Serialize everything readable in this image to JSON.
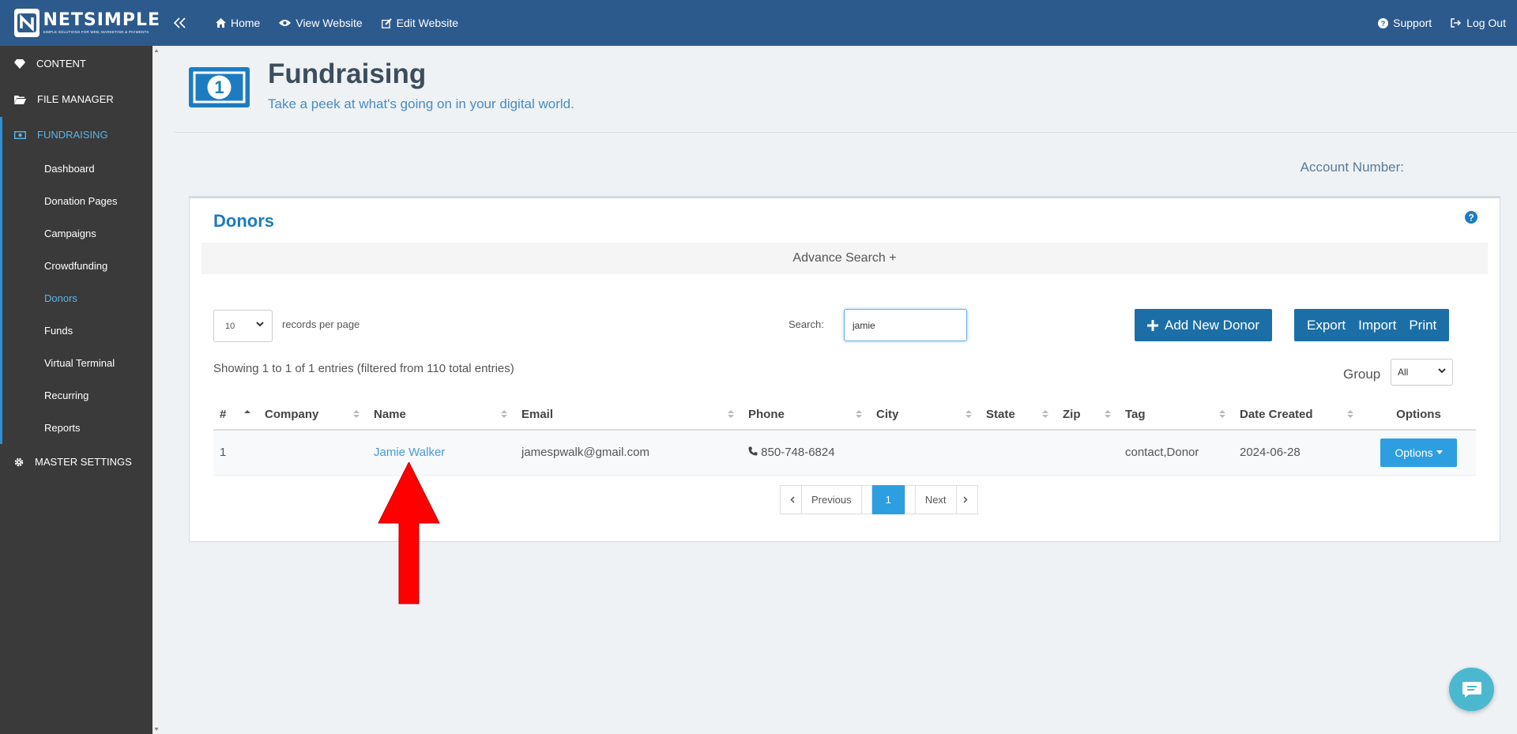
{
  "topbar": {
    "logo_name": "NETSIMPLE",
    "logo_tagline": "SIMPLE SOLUTIONS FOR WEB, MARKETING & PAYMENTS",
    "nav": [
      {
        "label": "Home",
        "icon": "home-icon"
      },
      {
        "label": "View Website",
        "icon": "eye-icon"
      },
      {
        "label": "Edit Website",
        "icon": "edit-icon"
      }
    ],
    "support_label": "Support",
    "logout_label": "Log Out"
  },
  "sidebar": {
    "items": [
      {
        "label": "CONTENT",
        "icon": "diamond-icon"
      },
      {
        "label": "FILE MANAGER",
        "icon": "folder-icon"
      },
      {
        "label": "FUNDRAISING",
        "icon": "money-icon",
        "active": true
      },
      {
        "label": "MASTER SETTINGS",
        "icon": "gear-icon"
      }
    ],
    "fundraising_sub": [
      "Dashboard",
      "Donation Pages",
      "Campaigns",
      "Crowdfunding",
      "Donors",
      "Funds",
      "Virtual Terminal",
      "Recurring",
      "Reports"
    ],
    "active_sub": "Donors"
  },
  "header": {
    "title": "Fundraising",
    "subtitle": "Take a peek at what's going on in your digital world.",
    "account_label": "Account Number:"
  },
  "donors": {
    "title": "Donors",
    "advance_search": "Advance Search +",
    "records_per_page_value": "10",
    "records_per_page_label": "records per page",
    "search_label": "Search:",
    "search_value": "jamie",
    "add_button": "Add New Donor",
    "export": "Export",
    "import": "Import",
    "print": "Print",
    "showing": "Showing 1 to 1 of 1 entries (filtered from 110 total entries)",
    "group_label": "Group",
    "group_value": "All",
    "columns": [
      "#",
      "Company",
      "Name",
      "Email",
      "Phone",
      "City",
      "State",
      "Zip",
      "Tag",
      "Date Created",
      "Options"
    ],
    "rows": [
      {
        "num": "1",
        "company": "",
        "name": "Jamie Walker",
        "email": "jamespwalk@gmail.com",
        "phone": "850-748-6824",
        "city": "",
        "state": "",
        "zip": "",
        "tag": "contact,Donor",
        "date": "2024-06-28",
        "options": "Options"
      }
    ],
    "pager": {
      "previous": "Previous",
      "current": "1",
      "next": "Next"
    }
  },
  "colors": {
    "topbar": "#2d5a8c",
    "sidebar": "#3a3a3a",
    "accent": "#1c7cbf",
    "annotation_arrow": "#ff0000"
  }
}
